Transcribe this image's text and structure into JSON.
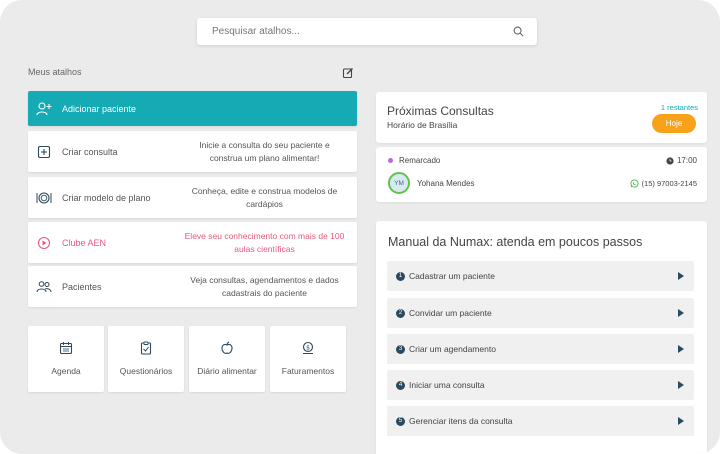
{
  "search": {
    "placeholder": "Pesquisar atalhos..."
  },
  "shortcuts": {
    "label": "Meus atalhos",
    "add_patient": "Adicionar paciente",
    "cards": [
      {
        "title": "Criar consulta",
        "desc": "Inicie a consulta do seu paciente e construa um plano alimentar!"
      },
      {
        "title": "Criar modelo de plano",
        "desc": "Conheça, edite e construa modelos de cardápios"
      },
      {
        "title": "Clube AEN",
        "desc": "Eleve seu conhecimento com mais de 100 aulas científicas"
      },
      {
        "title": "Pacientes",
        "desc": "Veja consultas, agendamentos e dados cadastrais do paciente"
      }
    ],
    "tiles": [
      {
        "label": "Agenda",
        "icon": "calendar-icon"
      },
      {
        "label": "Questionários",
        "icon": "clipboard-icon"
      },
      {
        "label": "Diário alimentar",
        "icon": "apple-icon"
      },
      {
        "label": "Faturamentos",
        "icon": "money-icon"
      }
    ]
  },
  "next_appointments": {
    "title": "Próximas Consultas",
    "subtitle": "Horário de Brasília",
    "remaining": "1 restantes",
    "today_button": "Hoje",
    "item": {
      "status": "Remarcado",
      "time": "17:00",
      "initials": "YM",
      "patient": "Yohana Mendes",
      "phone": "(15) 97003-2145"
    }
  },
  "manual": {
    "title": "Manual da Numax: atenda em poucos passos",
    "steps": [
      {
        "num": "1",
        "label": "Cadastrar um paciente"
      },
      {
        "num": "2",
        "label": "Convidar um paciente"
      },
      {
        "num": "3",
        "label": "Criar um agendamento"
      },
      {
        "num": "4",
        "label": "Iniciar uma consulta"
      },
      {
        "num": "5",
        "label": "Gerenciar itens da consulta"
      }
    ]
  },
  "colors": {
    "accent": "#15aab4",
    "today": "#f8a21c",
    "club_pink": "#e8587f",
    "status_purple": "#b56ad6",
    "whatsapp_green": "#4caf50",
    "step_dark": "#2b4a5e"
  }
}
